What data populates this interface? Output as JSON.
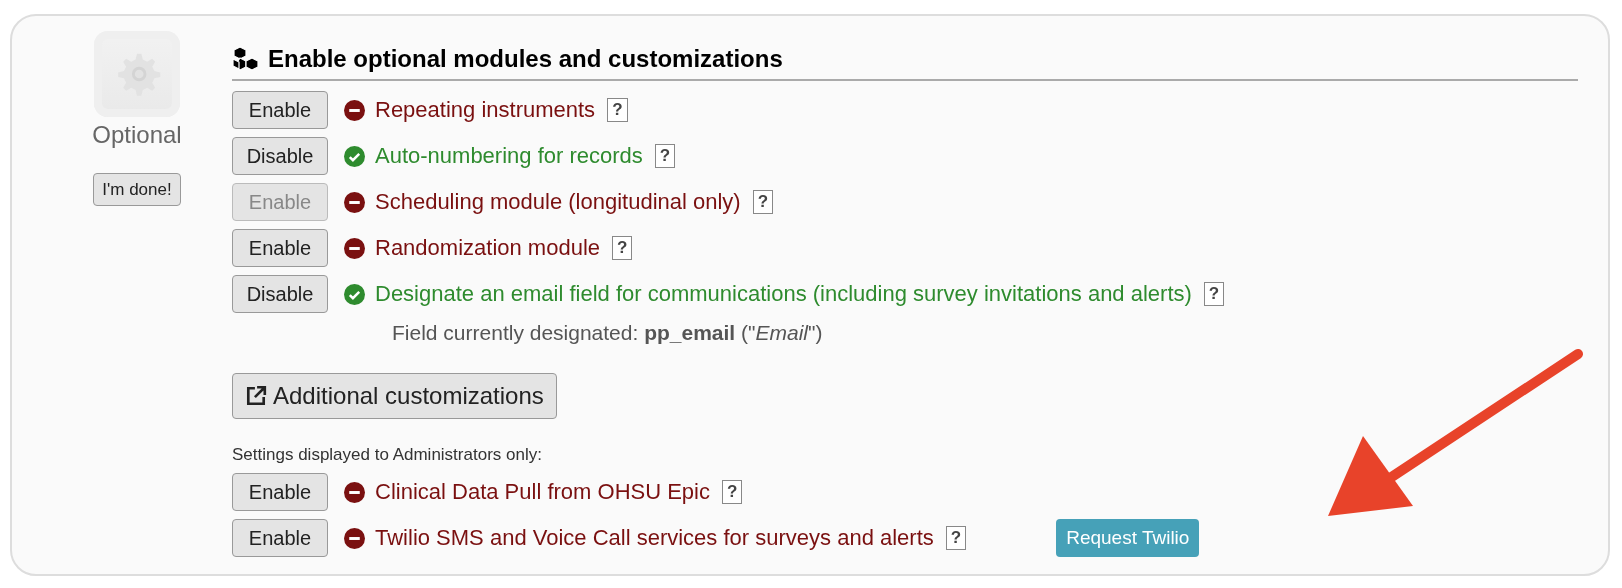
{
  "sidebar": {
    "label": "Optional",
    "button": "I'm done!"
  },
  "section": {
    "title": "Enable optional modules and customizations",
    "modules": [
      {
        "button": "Enable",
        "button_disabled": false,
        "enabled": false,
        "label": "Repeating instruments",
        "help": "?"
      },
      {
        "button": "Disable",
        "button_disabled": false,
        "enabled": true,
        "label": "Auto-numbering for records",
        "help": "?"
      },
      {
        "button": "Enable",
        "button_disabled": true,
        "enabled": false,
        "label": "Scheduling module (longitudinal only)",
        "help": "?"
      },
      {
        "button": "Enable",
        "button_disabled": false,
        "enabled": false,
        "label": "Randomization module",
        "help": "?"
      },
      {
        "button": "Disable",
        "button_disabled": false,
        "enabled": true,
        "label": "Designate an email field for communications (including survey invitations and alerts)",
        "help": "?",
        "note": "Field currently designated: **pp_email**  (\"*Email*\")"
      }
    ],
    "customizations_button": "Additional customizations",
    "admin_heading": "Settings displayed to Administrators only:",
    "admin_modules": [
      {
        "button": "Enable",
        "button_disabled": false,
        "enabled": false,
        "label": "Clinical Data Pull from OHSU Epic",
        "help": "?"
      },
      {
        "button": "Enable",
        "button_disabled": false,
        "enabled": false,
        "label": "Twilio SMS and Voice Call services for surveys and alerts",
        "help": "?",
        "action": "Request Twilio"
      }
    ]
  }
}
